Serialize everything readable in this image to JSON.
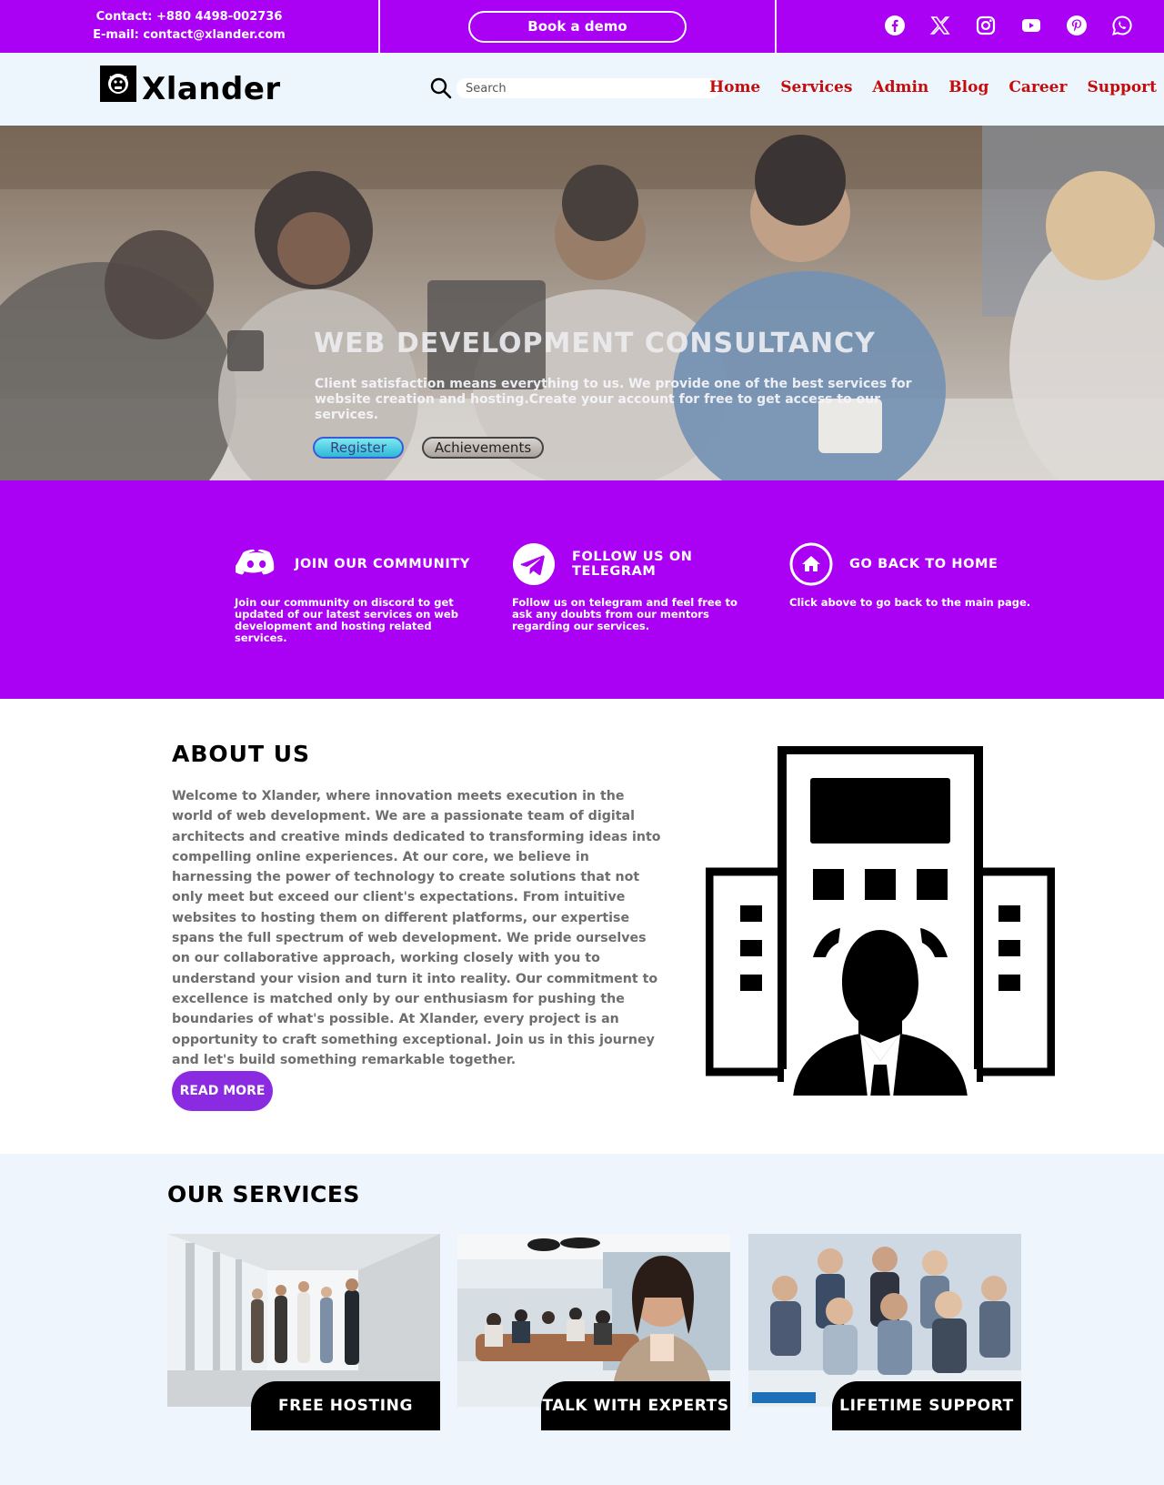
{
  "topbar": {
    "contact": "Contact: +880 4498-002736",
    "email": "E-mail: contact@xlander.com",
    "demo_button": "Book a demo",
    "social_icons": [
      "facebook-icon",
      "x-icon",
      "instagram-icon",
      "youtube-icon",
      "pinterest-icon",
      "whatsapp-icon"
    ]
  },
  "header": {
    "logo": "Xlander",
    "search_placeholder": "Search",
    "nav": [
      "Home",
      "Services",
      "Admin",
      "Blog",
      "Career",
      "Support"
    ]
  },
  "hero": {
    "title": "WEB DEVELOPMENT CONSULTANCY",
    "text": "Client satisfaction means everything to us. We provide one of the best services for website creation and hosting.Create your account for free to get access to our services.",
    "register": "Register",
    "achievements": "Achievements"
  },
  "features": [
    {
      "icon": "discord-icon",
      "title": "JOIN OUR COMMUNITY",
      "desc": "Join our community on discord to get updated of our latest services on web development and hosting related services."
    },
    {
      "icon": "telegram-icon",
      "title": "FOLLOW US ON TELEGRAM",
      "desc": "Follow us on telegram and feel free to ask any doubts from our mentors regarding our services."
    },
    {
      "icon": "home-icon",
      "title": "GO BACK TO HOME",
      "desc": "Click above to go back to the main page."
    }
  ],
  "about": {
    "title": "ABOUT US",
    "text": "Welcome to Xlander, where innovation meets execution in the world of web development. We are a passionate team of digital architects and creative minds dedicated to transforming ideas into compelling online experiences. At our core, we believe in harnessing the power of technology to create solutions that not only meet but exceed our client's expectations. From intuitive websites to hosting them on different platforms, our expertise spans the full spectrum of web development. We pride ourselves on our collaborative approach, working closely with you to understand your vision and turn it into reality. Our commitment to excellence is matched only by our enthusiasm for pushing the boundaries of what's possible. At Xlander, every project is an opportunity to craft something exceptional. Join us in this journey and let's build something remarkable together.",
    "read_more": "READ MORE"
  },
  "services": {
    "title": "OUR SERVICES",
    "cards": [
      "FREE HOSTING",
      "TALK WITH EXPERTS",
      "LIFETIME SUPPORT"
    ]
  },
  "colors": {
    "brand_purple": "#aa00f4",
    "nav_red": "#c40c0c",
    "button_purple": "#8a2be2"
  }
}
